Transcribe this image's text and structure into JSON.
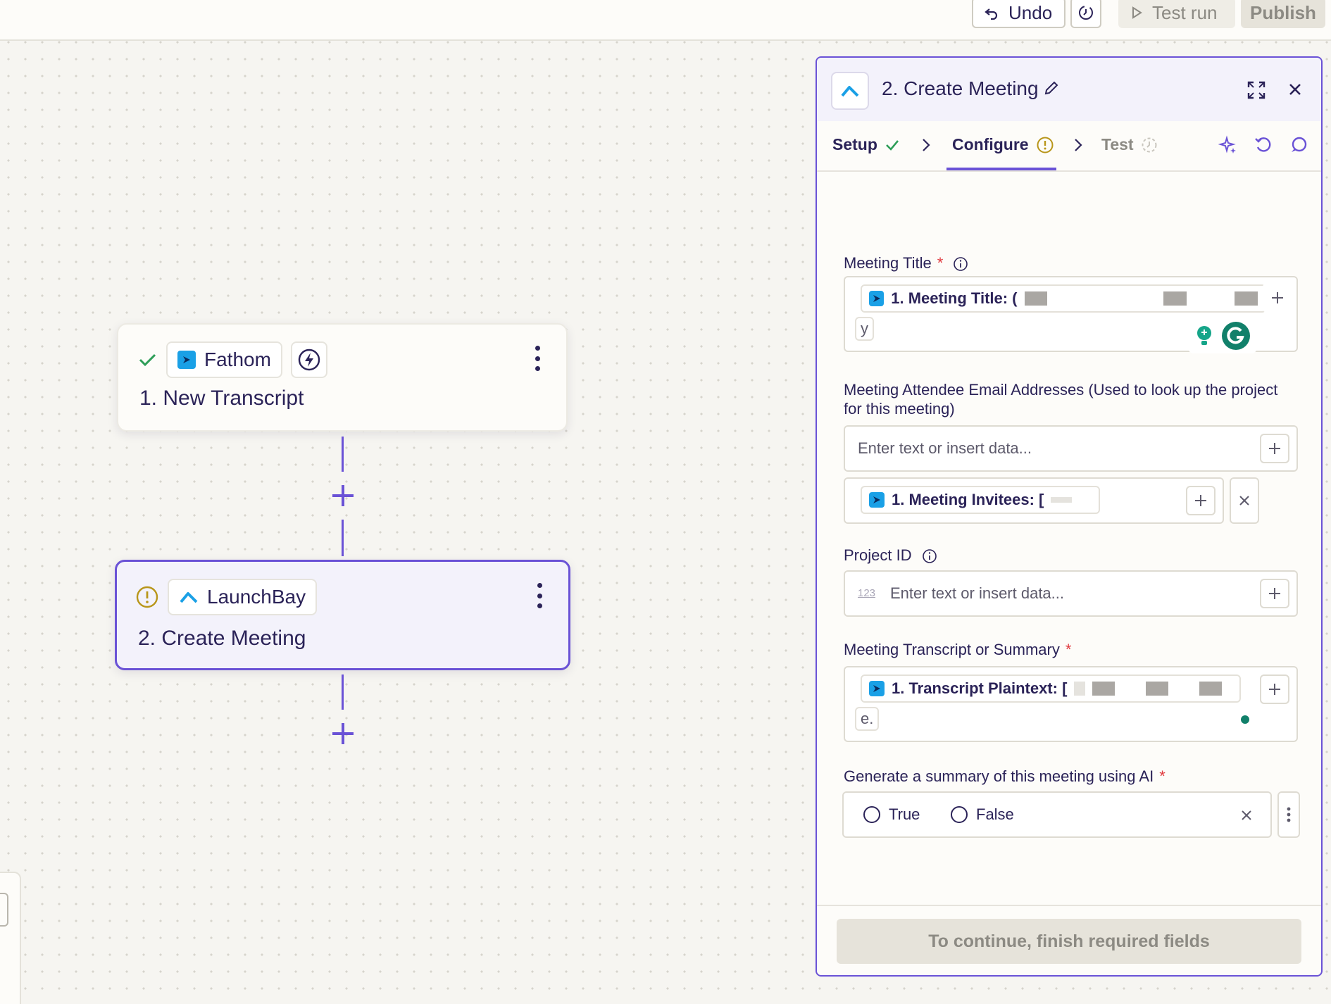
{
  "topbar": {
    "undo_label": "Undo",
    "test_run_label": "Test run",
    "publish_label": "Publish"
  },
  "canvas": {
    "nodes": [
      {
        "app": "Fathom",
        "title": "1. New Transcript",
        "status": "success"
      },
      {
        "app": "LaunchBay",
        "title": "2. Create Meeting",
        "status": "warning"
      }
    ]
  },
  "panel": {
    "title": "2. Create Meeting",
    "tabs": {
      "setup": "Setup",
      "configure": "Configure",
      "test": "Test"
    },
    "fields": {
      "meeting_title": {
        "label": "Meeting Title",
        "pill": "1. Meeting Title: (",
        "tail": "y"
      },
      "attendees": {
        "label": "Meeting Attendee Email Addresses (Used to look up the project for this meeting)",
        "placeholder": "Enter text or insert data...",
        "pill": "1. Meeting Invitees: ["
      },
      "project_id": {
        "label": "Project ID",
        "type_hint": "123",
        "placeholder": "Enter text or insert data..."
      },
      "transcript": {
        "label": "Meeting Transcript or Summary",
        "pill": "1. Transcript Plaintext: [",
        "tail": "e."
      },
      "ai_summary": {
        "label": "Generate a summary of this meeting using AI",
        "options": [
          "True",
          "False"
        ]
      }
    },
    "footer_label": "To continue, finish required fields"
  },
  "colors": {
    "accent": "#6a52d6",
    "required": "#e0393e",
    "success": "#2e9e58",
    "warning": "#b8961a",
    "fathom": "#1aa0e6"
  }
}
